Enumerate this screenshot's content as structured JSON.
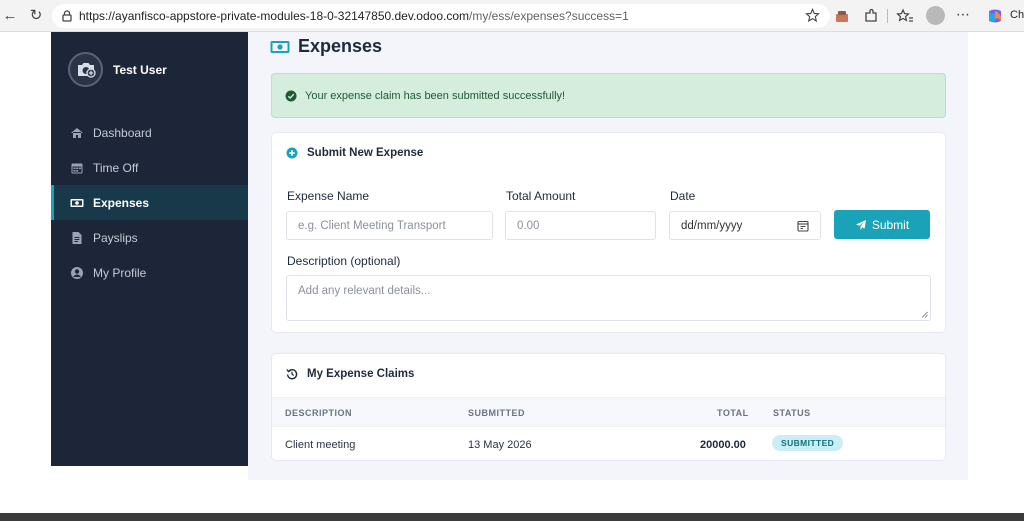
{
  "browser": {
    "url_host": "https://ayanfisco-appstore-private-modules-18-0-32147850.dev.odoo.com",
    "url_path": "/my/ess/expenses?success=1",
    "copilot_label": "Ch"
  },
  "sidebar": {
    "user_name": "Test User",
    "items": [
      {
        "label": "Dashboard",
        "icon": "home-icon"
      },
      {
        "label": "Time Off",
        "icon": "calendar-icon"
      },
      {
        "label": "Expenses",
        "icon": "money-icon"
      },
      {
        "label": "Payslips",
        "icon": "document-icon"
      },
      {
        "label": "My Profile",
        "icon": "user-icon"
      }
    ],
    "active_index": 2
  },
  "page": {
    "title": "Expenses"
  },
  "alert": {
    "message": "Your expense claim has been submitted successfully!"
  },
  "submit_form": {
    "heading": "Submit New Expense",
    "expense_name_label": "Expense Name",
    "expense_name_placeholder": "e.g. Client Meeting Transport",
    "total_amount_label": "Total Amount",
    "total_amount_placeholder": "0.00",
    "date_label": "Date",
    "date_placeholder": "dd/mm/yyyy",
    "submit_label": "Submit",
    "description_label": "Description (optional)",
    "description_placeholder": "Add any relevant details..."
  },
  "claims": {
    "heading": "My Expense Claims",
    "columns": {
      "description": "DESCRIPTION",
      "submitted": "SUBMITTED",
      "total": "TOTAL",
      "status": "STATUS"
    },
    "rows": [
      {
        "description": "Client meeting",
        "submitted": "13 May 2026",
        "total": "20000.00",
        "status": "SUBMITTED"
      }
    ]
  },
  "colors": {
    "sidebar_bg": "#1d2538",
    "accent": "#1aa3b8",
    "success_bg": "#d4eddc"
  }
}
